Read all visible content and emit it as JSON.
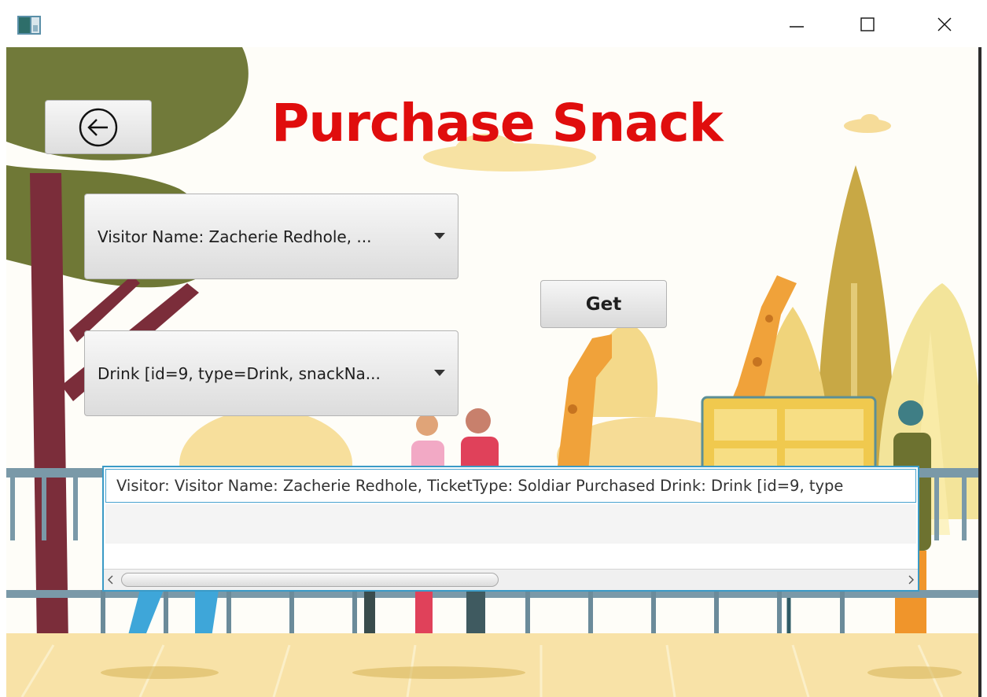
{
  "window": {
    "app_icon": "app-window-icon",
    "minimize_icon": "minimize-icon",
    "maximize_icon": "maximize-icon",
    "close_icon": "close-icon"
  },
  "header": {
    "title": "Purchase Snack",
    "back_icon": "back-arrow-circle-icon"
  },
  "form": {
    "visitor_select": {
      "selected": "Visitor Name: Zacherie Redhole, ..."
    },
    "snack_select": {
      "selected": "Drink [id=9, type=Drink, snackNa..."
    },
    "get_label": "Get"
  },
  "results": {
    "items": [
      "Visitor: Visitor Name: Zacherie Redhole, TicketType: Soldiar Purchased Drink: Drink [id=9, type"
    ]
  },
  "colors": {
    "title": "#e00d0d",
    "selection_border": "#3a9ac6"
  }
}
